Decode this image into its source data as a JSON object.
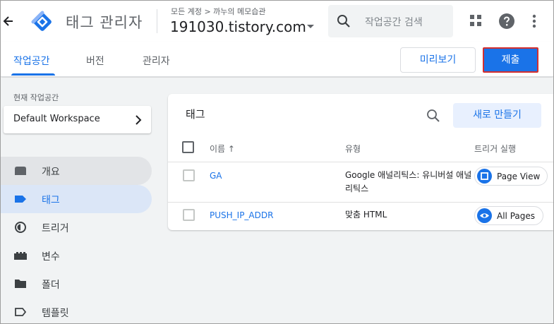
{
  "header": {
    "app_title": "태그 관리자",
    "breadcrumb": "모든 계정 > 까누의 메모습관",
    "container_name": "191030.tistory.com",
    "search_placeholder": "작업공간 검색"
  },
  "tabs": [
    {
      "label": "작업공간",
      "active": true
    },
    {
      "label": "버전",
      "active": false
    },
    {
      "label": "관리자",
      "active": false
    }
  ],
  "actions": {
    "preview_label": "미리보기",
    "submit_label": "제출"
  },
  "sidebar": {
    "workspace_label": "현재 작업공간",
    "workspace_name": "Default Workspace",
    "items": [
      {
        "label": "개요",
        "icon": "overview-icon"
      },
      {
        "label": "태그",
        "icon": "tag-icon"
      },
      {
        "label": "트리거",
        "icon": "trigger-icon"
      },
      {
        "label": "변수",
        "icon": "variable-icon"
      },
      {
        "label": "폴더",
        "icon": "folder-icon"
      },
      {
        "label": "템플릿",
        "icon": "template-icon"
      }
    ]
  },
  "tags_panel": {
    "title": "태그",
    "new_button": "새로 만들기",
    "columns": {
      "name": "이름 ↑",
      "type": "유형",
      "triggers": "트리거 실행"
    },
    "rows": [
      {
        "name": "GA",
        "type": "Google 애널리틱스: 유니버설 애널리틱스",
        "trigger": "Page View",
        "trigger_icon": "page-view-icon"
      },
      {
        "name": "PUSH_IP_ADDR",
        "type": "맞춤 HTML",
        "trigger": "All Pages",
        "trigger_icon": "eye-icon"
      }
    ]
  },
  "colors": {
    "accent": "#1a73e8",
    "submit_outline": "#d32f2f",
    "background": "#f1f3f4"
  }
}
